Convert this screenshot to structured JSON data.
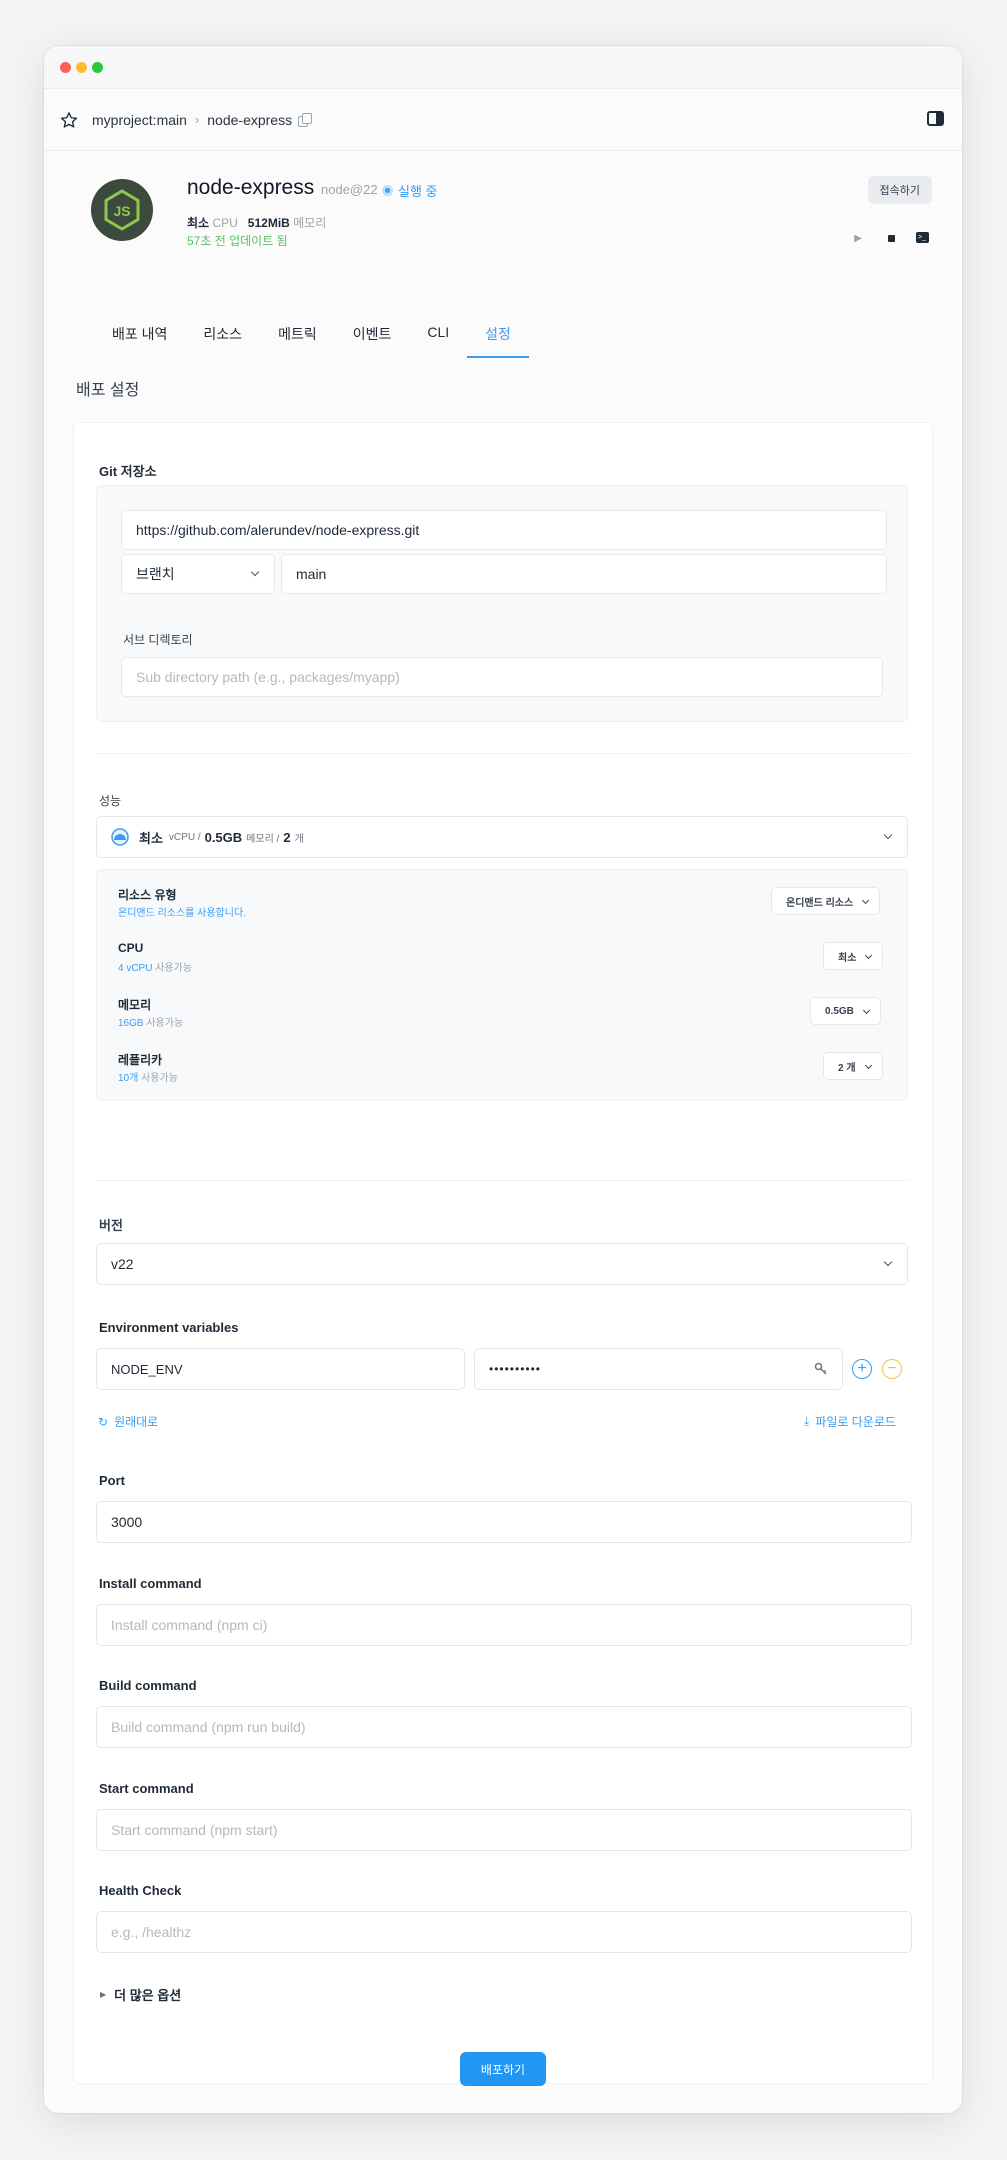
{
  "window": {
    "controls": {
      "close": "#ff5f57",
      "minimize": "#febc2e",
      "maximize": "#28c840"
    }
  },
  "breadcrumb": {
    "project": "myproject:main",
    "separator": "›",
    "service": "node-express"
  },
  "header": {
    "name": "node-express",
    "version": "node@22",
    "status": "실행 중",
    "connect_label": "접속하기",
    "cpu_value": "최소",
    "cpu_unit": "CPU",
    "memory_value": "512MiB",
    "memory_unit": "메모리",
    "updated": "57초 전 업데이트 됨"
  },
  "tabs": [
    "배포 내역",
    "리소스",
    "메트릭",
    "이벤트",
    "CLI",
    "설정"
  ],
  "active_tab": "설정",
  "section_title": "배포 설정",
  "git": {
    "label": "Git 저장소",
    "repo_url": "https://github.com/alerundev/node-express.git",
    "branch_type": "브랜치",
    "branch": "main",
    "subdir_label": "서브 디렉토리",
    "subdir_placeholder": "Sub directory path (e.g., packages/myapp)"
  },
  "performance": {
    "label": "성능",
    "summary": {
      "tier": "최소",
      "cpu_unit": "vCPU /",
      "memory": "0.5GB",
      "memory_unit": "메모리 /",
      "replicas": "2",
      "replicas_unit": "개"
    },
    "rows": [
      {
        "title": "리소스 유형",
        "sub_hl": "온디맨드 리소스를 사용합니다.",
        "sub": "",
        "value": "온디맨드 리소스"
      },
      {
        "title": "CPU",
        "sub_hl": "4 vCPU",
        "sub": "사용가능",
        "value": "최소"
      },
      {
        "title": "메모리",
        "sub_hl": "16GB",
        "sub": "사용가능",
        "value": "0.5GB"
      },
      {
        "title": "레플리카",
        "sub_hl": "10개",
        "sub": "사용가능",
        "value": "2 개"
      }
    ]
  },
  "version": {
    "label": "버전",
    "value": "v22"
  },
  "env": {
    "label": "Environment variables",
    "key": "NODE_ENV",
    "value_masked": "••••••••••",
    "reset_label": "원래대로",
    "download_label": "파일로 다운로드"
  },
  "port": {
    "label": "Port",
    "value": "3000"
  },
  "install": {
    "label": "Install command",
    "placeholder": "Install command (npm ci)"
  },
  "build": {
    "label": "Build command",
    "placeholder": "Build command (npm run build)"
  },
  "start": {
    "label": "Start command",
    "placeholder": "Start command (npm start)"
  },
  "health": {
    "label": "Health Check",
    "placeholder": "e.g., /healthz"
  },
  "more_options": "더 많은 옵션",
  "deploy_label": "배포하기"
}
